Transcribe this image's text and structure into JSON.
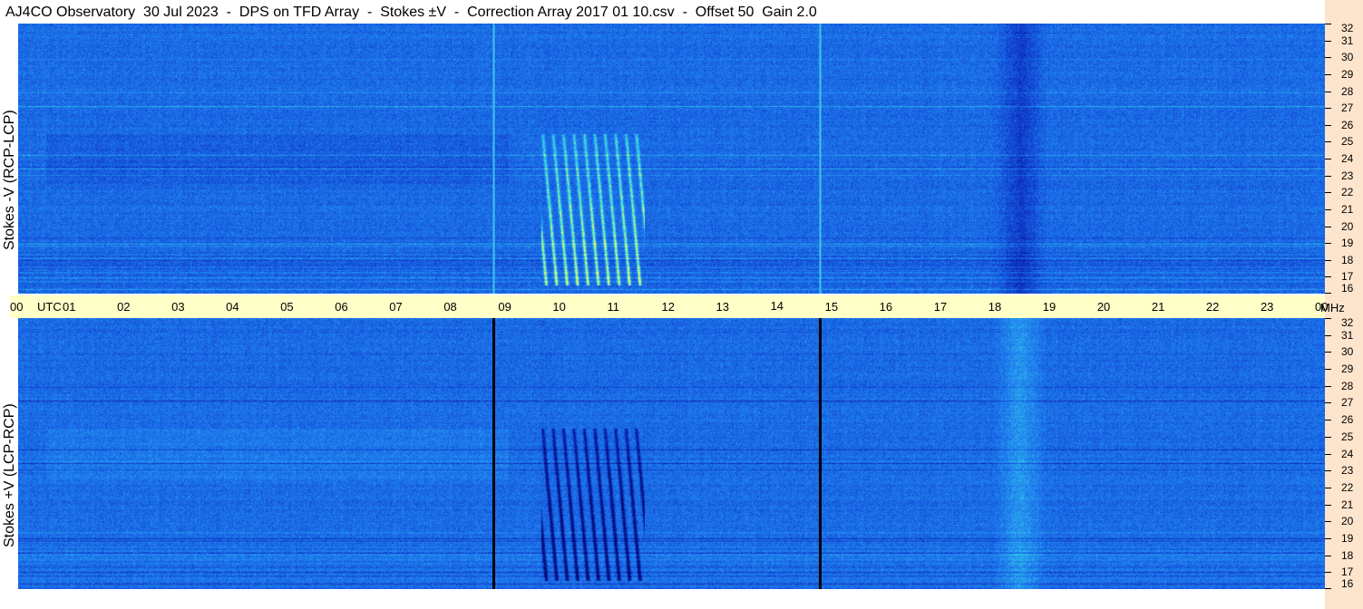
{
  "title": "AJ4CO Observatory  30 Jul 2023  -  DPS on TFD Array  -  Stokes ±V  -  Correction Array 2017 01 10.csv  -  Offset 50  Gain 2.0",
  "colors": {
    "background": "#1a6ee8",
    "strip_right": "#fde4cc",
    "time_band": "#ffffc8",
    "top_marker_line": "#3fc4e8",
    "bottom_marker_line": "#000000"
  },
  "chart_data": [
    {
      "type": "heatmap",
      "panel": "top",
      "ylabel": "Stokes -V  (RCP-LCP)",
      "x_ticks": [
        "00",
        "01",
        "02",
        "03",
        "04",
        "05",
        "06",
        "07",
        "08",
        "09",
        "10",
        "11",
        "12",
        "13",
        "14",
        "15",
        "16",
        "17",
        "18",
        "19",
        "20",
        "21",
        "22",
        "23",
        "00"
      ],
      "x_unit_label": "UTC",
      "xlim": [
        0,
        24
      ],
      "y_ticks": [
        "16",
        "17",
        "18",
        "19",
        "20",
        "21",
        "22",
        "23",
        "24",
        "25",
        "26",
        "27",
        "28",
        "29",
        "30",
        "31",
        "32"
      ],
      "y_unit_label": "MHz",
      "ylim": [
        16,
        32
      ],
      "marker_lines_utc": [
        8.73,
        14.73
      ],
      "features": [
        {
          "kind": "burst",
          "t_start_utc": 9.6,
          "t_end_utc": 11.5,
          "f_low_mhz": 16.5,
          "f_high_mhz": 25.5,
          "polarity": "bright"
        },
        {
          "kind": "dark_band",
          "t_start_utc": 17.9,
          "t_end_utc": 18.9,
          "polarity": "dark"
        }
      ]
    },
    {
      "type": "heatmap",
      "panel": "bottom",
      "ylabel": "Stokes +V  (LCP-RCP)",
      "xlim": [
        0,
        24
      ],
      "y_ticks": [
        "16",
        "17",
        "18",
        "19",
        "20",
        "21",
        "22",
        "23",
        "24",
        "25",
        "26",
        "27",
        "28",
        "29",
        "30",
        "31",
        "32"
      ],
      "ylim": [
        16,
        32
      ],
      "marker_lines_utc": [
        8.73,
        14.73
      ],
      "features": [
        {
          "kind": "burst",
          "t_start_utc": 9.6,
          "t_end_utc": 11.5,
          "f_low_mhz": 16.5,
          "f_high_mhz": 25.5,
          "polarity": "dark"
        },
        {
          "kind": "bright_band",
          "t_start_utc": 17.9,
          "t_end_utc": 18.9,
          "polarity": "bright"
        }
      ]
    }
  ]
}
